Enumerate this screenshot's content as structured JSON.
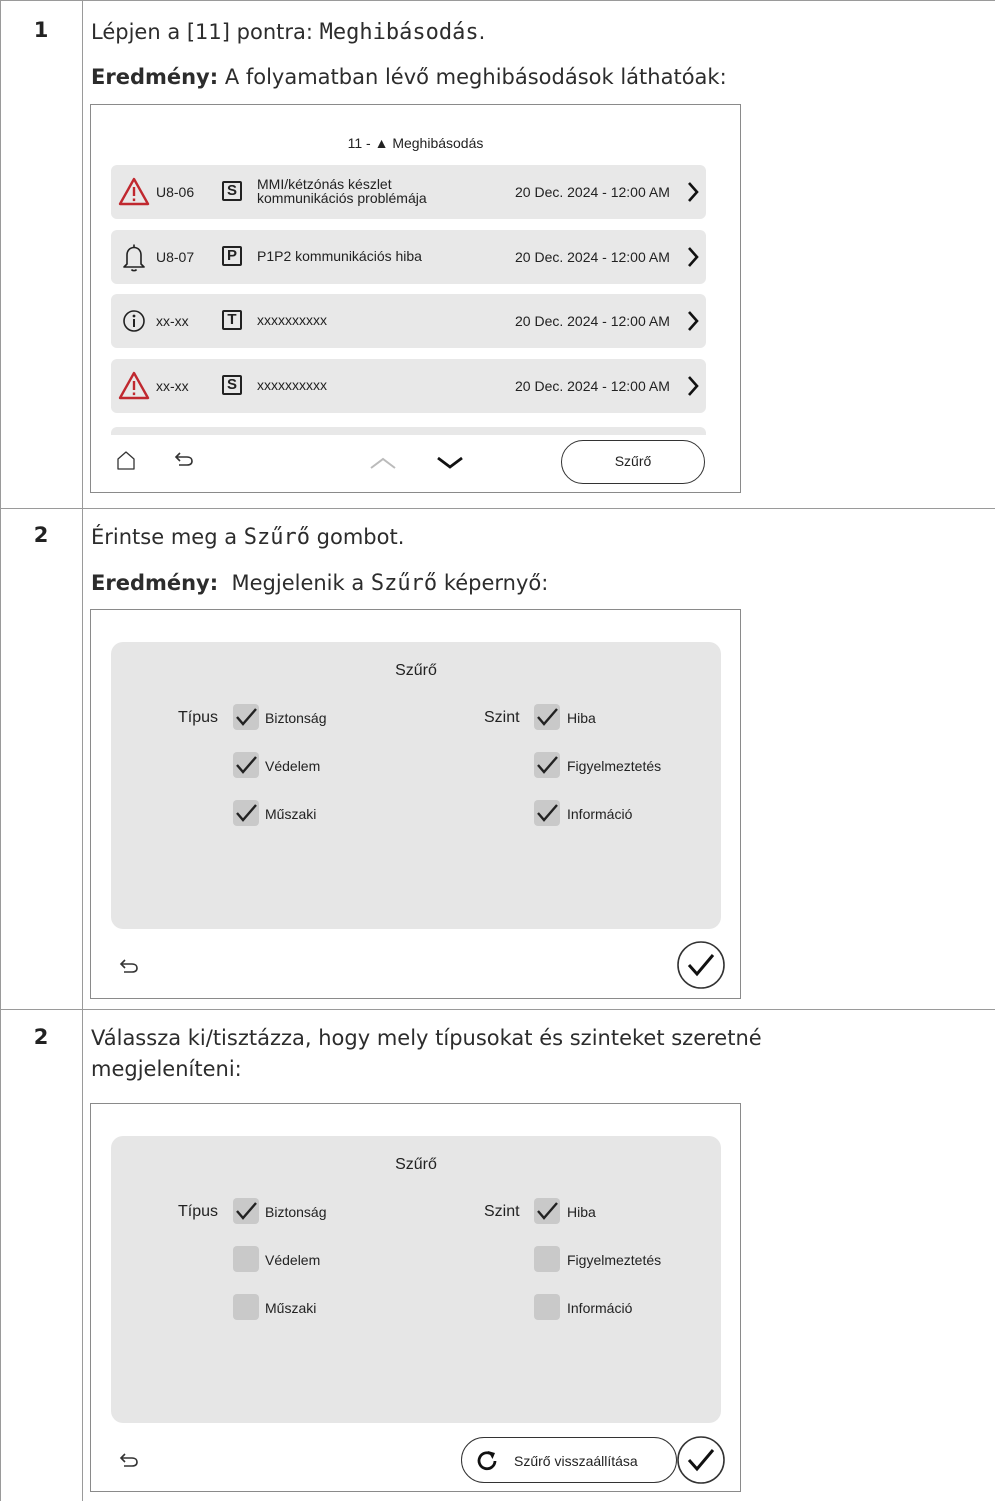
{
  "steps": [
    {
      "number": "1",
      "line1": {
        "prefix": "Lépjen a [11] pontra: ",
        "code": "Meghibásodás",
        "suffix": "."
      },
      "line2": {
        "label": "Eredmény:",
        "text": " A folyamatban lévő meghibásodások láthatóak:"
      },
      "screen": {
        "title": "11 - ▲ Meghibásodás",
        "rows": [
          {
            "icon": "warning-triangle-icon",
            "code": "U8-06",
            "type": "S",
            "desc_line1": "MMI/kétzónás készlet",
            "desc_line2": "kommunikációs problémája",
            "date": "20 Dec. 2024 - 12:00 AM"
          },
          {
            "icon": "bell-icon",
            "code": "U8-07",
            "type": "P",
            "desc_line1": "P1P2 kommunikációs hiba",
            "desc_line2": "",
            "date": "20 Dec. 2024 - 12:00 AM"
          },
          {
            "icon": "info-circle-icon",
            "code": "xx-xx",
            "type": "T",
            "desc_line1": "xxxxxxxxxx",
            "desc_line2": "",
            "date": "20 Dec. 2024 - 12:00 AM"
          },
          {
            "icon": "warning-triangle-icon",
            "code": "xx-xx",
            "type": "S",
            "desc_line1": "xxxxxxxxxx",
            "desc_line2": "",
            "date": "20 Dec. 2024 - 12:00 AM"
          }
        ],
        "filter_button": "Szűrő"
      }
    },
    {
      "number": "2",
      "line1": {
        "prefix": "Érintse meg a ",
        "code": "Szűrő",
        "suffix": " gombot."
      },
      "line2": {
        "label": "Eredmény:",
        "text": "  Megjelenik a ",
        "code": "Szűrő",
        "suffix": " képernyő:"
      },
      "screen": {
        "title": "Szűrő",
        "type_label": "Típus",
        "level_label": "Szint",
        "types": [
          {
            "label": "Biztonság",
            "checked": true
          },
          {
            "label": "Védelem",
            "checked": true
          },
          {
            "label": "Műszaki",
            "checked": true
          }
        ],
        "levels": [
          {
            "label": "Hiba",
            "checked": true
          },
          {
            "label": "Figyelmeztetés",
            "checked": true
          },
          {
            "label": "Információ",
            "checked": true
          }
        ]
      }
    },
    {
      "number": "2",
      "line1": {
        "text": "Válassza ki/tisztázza, hogy mely típusokat és szinteket szeretné"
      },
      "line2": {
        "text": "megjeleníteni:"
      },
      "screen": {
        "title": "Szűrő",
        "type_label": "Típus",
        "level_label": "Szint",
        "types": [
          {
            "label": "Biztonság",
            "checked": true
          },
          {
            "label": "Védelem",
            "checked": false
          },
          {
            "label": "Műszaki",
            "checked": false
          }
        ],
        "levels": [
          {
            "label": "Hiba",
            "checked": true
          },
          {
            "label": "Figyelmeztetés",
            "checked": false
          },
          {
            "label": "Információ",
            "checked": false
          }
        ],
        "reset_button": "Szűrő visszaállítása"
      }
    }
  ],
  "colors": {
    "warning": "#c0282f",
    "panel": "#e6e6e6",
    "row": "#e8e8e8",
    "checkbox": "#c9c9c9",
    "border": "#9a9a9a"
  }
}
